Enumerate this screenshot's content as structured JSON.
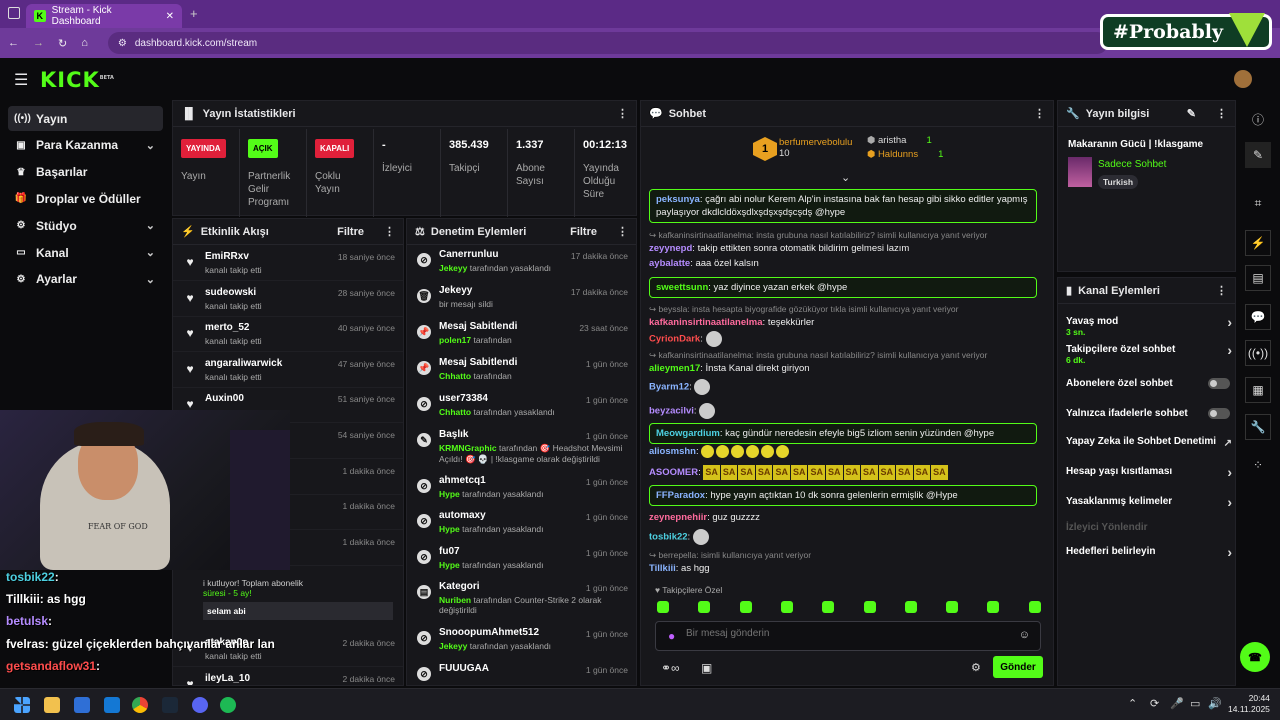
{
  "browser": {
    "tab_title": "Stream - Kick Dashboard",
    "url": "dashboard.kick.com/stream"
  },
  "overlay_brand": "#Probably",
  "logo": "KICK",
  "logo_beta": "BETA",
  "sidebar": [
    {
      "label": "Yayın",
      "icon": "broadcast-icon",
      "active": true
    },
    {
      "label": "Para Kazanma",
      "icon": "money-icon",
      "chevron": true
    },
    {
      "label": "Başarılar",
      "icon": "trophy-icon"
    },
    {
      "label": "Droplar ve Ödüller",
      "icon": "gift-icon"
    },
    {
      "label": "Stüdyo",
      "icon": "studio-icon",
      "chevron": true
    },
    {
      "label": "Kanal",
      "icon": "channel-icon",
      "chevron": true
    },
    {
      "label": "Ayarlar",
      "icon": "settings-icon",
      "chevron": true
    }
  ],
  "stats": {
    "title": "Yayın İstatistikleri",
    "items": [
      {
        "badge": "YAYINDA",
        "badge_color": "#e0203a",
        "label": "Yayın"
      },
      {
        "badge": "AÇIK",
        "badge_color": "#53fc18",
        "label": "Partnerlik Gelir Programı"
      },
      {
        "badge": "KAPALI",
        "badge_color": "#e0203a",
        "label": "Çoklu Yayın"
      },
      {
        "value": "-",
        "label": "İzleyici"
      },
      {
        "value": "385.439",
        "label": "Takipçi"
      },
      {
        "value": "1.337",
        "label": "Abone Sayısı"
      },
      {
        "value": "00:12:13",
        "label": "Yayında Olduğu Süre"
      }
    ]
  },
  "activity": {
    "title": "Etkinlik Akışı",
    "filter": "Filtre",
    "items": [
      {
        "name": "EmiRRxv",
        "sub": "kanalı takip etti",
        "time": "18 saniye önce"
      },
      {
        "name": "sudeowski",
        "sub": "kanalı takip etti",
        "time": "28 saniye önce"
      },
      {
        "name": "merto_52",
        "sub": "kanalı takip etti",
        "time": "40 saniye önce"
      },
      {
        "name": "angaraliwarwick",
        "sub": "kanalı takip etti",
        "time": "47 saniye önce"
      },
      {
        "name": "Auxin00",
        "sub": "",
        "time": "51 saniye önce"
      },
      {
        "name": "",
        "sub": "",
        "time": "54 saniye önce"
      },
      {
        "name": "",
        "sub": "",
        "time": "1 dakika önce"
      },
      {
        "name": "",
        "sub": "",
        "time": "1 dakika önce"
      },
      {
        "name": "",
        "sub": "",
        "time": "1 dakika önce"
      }
    ],
    "sub_message": "i kutluyor! Toplam abonelik",
    "sub_months": "süresi - 5 ay!",
    "sub_note": "selam abi",
    "after": [
      {
        "name": "atakan0o",
        "sub": "kanalı takip etti",
        "time": "2 dakika önce"
      },
      {
        "name": "ileyLa_10",
        "sub": "kanalı takip etti",
        "time": "2 dakika önce"
      }
    ]
  },
  "moderation": {
    "title": "Denetim Eylemleri",
    "filter": "Filtre",
    "items": [
      {
        "name": "Canerrunluu",
        "actor": "Jekeyy",
        "sub": "tarafından yasaklandı",
        "time": "17 dakika önce",
        "icon": "ban-icon"
      },
      {
        "name": "Jekeyy",
        "actor": "",
        "sub": "bir mesajı sildi",
        "time": "17 dakika önce",
        "icon": "trash-icon"
      },
      {
        "name": "Mesaj Sabitlendi",
        "actor": "polen17",
        "sub": "tarafından",
        "time": "23 saat önce",
        "icon": "pin-icon"
      },
      {
        "name": "Mesaj Sabitlendi",
        "actor": "Chhatto",
        "sub": "tarafından",
        "time": "1 gün önce",
        "icon": "pin-icon"
      },
      {
        "name": "user73384",
        "actor": "Chhatto",
        "sub": "tarafından yasaklandı",
        "time": "1 gün önce",
        "icon": "ban-icon"
      },
      {
        "name": "Başlık",
        "actor": "KRMNGraphic",
        "sub": "tarafından 🎯 Headshot Mevsimi Açıldı! 🎯 💀 | !klasgame olarak değiştirildi",
        "time": "1 gün önce",
        "icon": "edit-icon"
      },
      {
        "name": "ahmetcq1",
        "actor": "Hype",
        "sub": "tarafından yasaklandı",
        "time": "1 gün önce",
        "icon": "ban-icon"
      },
      {
        "name": "automaxy",
        "actor": "Hype",
        "sub": "tarafından yasaklandı",
        "time": "1 gün önce",
        "icon": "ban-icon"
      },
      {
        "name": "fu07",
        "actor": "Hype",
        "sub": "tarafından yasaklandı",
        "time": "1 gün önce",
        "icon": "ban-icon"
      },
      {
        "name": "Kategori",
        "actor": "Nuriben",
        "sub": "tarafından Counter-Strike 2 olarak değiştirildi",
        "time": "1 gün önce",
        "icon": "category-icon"
      },
      {
        "name": "SnooopumAhmet512",
        "actor": "Jekeyy",
        "sub": "tarafından yasaklandı",
        "time": "1 gün önce",
        "icon": "ban-icon"
      },
      {
        "name": "FUUUGAA",
        "actor": "",
        "sub": "",
        "time": "1 gün önce",
        "icon": "ban-icon"
      }
    ]
  },
  "chat": {
    "title": "Sohbet",
    "top_gifters": [
      {
        "name": "berfumervebolulu",
        "count": "10"
      },
      {
        "name": "aristha",
        "count": "1"
      },
      {
        "name": "Haldunns",
        "count": "1"
      }
    ],
    "rank": "1",
    "messages": [
      {
        "user": "peksunya",
        "text": "çağrı abi nolur Kerem Alp'in instasına bak fan hesap gibi sikko editler yapmış paylaşıyor dkdlcldöxşdlxşdşxşdşcşdş @hype",
        "hl": true,
        "ucls": "u1"
      },
      {
        "reply": "kafkaninsirtinaatilanelma: insta grubuna nasıl katılabiliriz? isimli kullanıcıya yanıt veriyor",
        "user": "zeyynepd",
        "text": "takip ettikten sonra otomatik bildirim gelmesi lazım",
        "ucls": "u4"
      },
      {
        "user": "aybalatte",
        "text": "aaa özel kalsın",
        "ucls": "u4"
      },
      {
        "user": "sweettsunn",
        "text": "yaz diyince yazan erkek @hype",
        "hl": true,
        "ucls": "u2"
      },
      {
        "reply": "beyssla: insta hesapta biyografide gözüküyor tıkla isimli kullanıcıya yanıt veriyor",
        "user": "kafkaninsirtinaatilanelma",
        "text": "teşekkürler",
        "ucls": "u3"
      },
      {
        "user": "CyrionDark",
        "text": "",
        "ucls": "u5"
      },
      {
        "reply": "kafkaninsirtinaatilanelma: insta grubuna nasıl katılabiliriz? isimli kullanıcıya yanıt veriyor",
        "user": "alieymen17",
        "text": "İnsta Kanal direkt giriyon",
        "ucls": "u2"
      },
      {
        "user": "Byarm12",
        "text": "",
        "ucls": "u1"
      },
      {
        "user": "beyzacilvi",
        "text": "",
        "ucls": "u4"
      },
      {
        "user": "Meowgardium",
        "text": "kaç gündür neredesin efeyle big5 izliom senin yüzünden @hype",
        "hl": true,
        "ucls": "u6"
      },
      {
        "user": "aliosmshn",
        "text": "",
        "ucls": "u1"
      },
      {
        "user": "ASOOMER",
        "text": "SA",
        "ucls": "u4"
      },
      {
        "user": "FFParadox",
        "text": "hype yayın açtıktan 10 dk sonra gelenlerin ermişlik @Hype",
        "hl": true,
        "ucls": "u1"
      },
      {
        "user": "zeynepnehiir",
        "text": "guz guzzzz",
        "ucls": "u3"
      },
      {
        "user": "tosbik22",
        "text": "",
        "ucls": "u6"
      },
      {
        "reply": "berrepella: isimli kullanıcıya yanıt veriyor",
        "user": "Tillkiii",
        "text": "as hgg",
        "ucls": "u1"
      }
    ],
    "mode": "Takipçilere Özel",
    "placeholder": "Bir mesaj gönderin",
    "send": "Gönder"
  },
  "stream_info": {
    "title": "Yayın bilgisi",
    "stream_title": "Makaranın Gücü | !klasgame",
    "category": "Sadece Sohbet",
    "tag": "Turkish"
  },
  "channel_actions": {
    "title": "Kanal Eylemleri",
    "items": [
      {
        "label": "Yavaş mod",
        "sub": "3 sn.",
        "type": "arrow"
      },
      {
        "label": "Takipçilere özel sohbet",
        "sub": "6 dk.",
        "type": "arrow"
      },
      {
        "label": "Abonelere özel sohbet",
        "type": "toggle"
      },
      {
        "label": "Yalnızca ifadelerle sohbet",
        "type": "toggle"
      },
      {
        "label": "Yapay Zeka ile Sohbet Denetimi",
        "type": "external"
      },
      {
        "label": "Hesap yaşı kısıtlaması",
        "type": "arrow"
      },
      {
        "label": "Yasaklanmış kelimeler",
        "type": "arrow"
      },
      {
        "label": "İzleyici Yönlendir",
        "type": "disabled"
      },
      {
        "label": "Hedefleri belirleyin",
        "type": "arrow"
      }
    ]
  },
  "overlay_chat": [
    {
      "user": "tosbik22",
      "text": ":",
      "color": "#4dd0e1"
    },
    {
      "user": "Tillkiii",
      "text": ": as hgg",
      "color": "#ffffff"
    },
    {
      "user": "betulsk",
      "text": ":",
      "color": "#b58cff"
    },
    {
      "user": "fvelras",
      "text": ": güzel çiçeklerden bahçıvanlar anlar lan",
      "color": "#ffffff"
    },
    {
      "user": "getsandaflow31",
      "text": ":",
      "color": "#ff4d4d"
    }
  ],
  "overlay_tee_text": "FEAR OF GOD",
  "clock": {
    "time": "20:44",
    "date": "14.11.2025"
  },
  "accent": "#53fc18"
}
